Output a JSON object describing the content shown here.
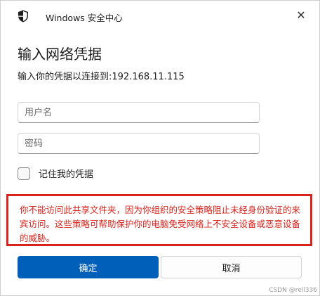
{
  "titlebar": {
    "app_title": "Windows 安全中心",
    "close_glyph": "✕"
  },
  "dialog": {
    "heading": "输入网络凭据",
    "subtitle": "输入你的凭据以连接到:192.168.11.115",
    "username_placeholder": "用户名",
    "password_placeholder": "密码",
    "remember_label": "记住我的凭据",
    "remember_checked": false,
    "warning_text": "你不能访问此共享文件夹，因为你组织的安全策略阻止未经身份验证的来宾访问。这些策略可帮助保护你的电脑免受网络上不安全设备或恶意设备的威胁。",
    "ok_label": "确定",
    "cancel_label": "取消"
  },
  "watermark": "CSDN @rell336",
  "colors": {
    "accent": "#005fb8",
    "warning": "#d9231c"
  }
}
